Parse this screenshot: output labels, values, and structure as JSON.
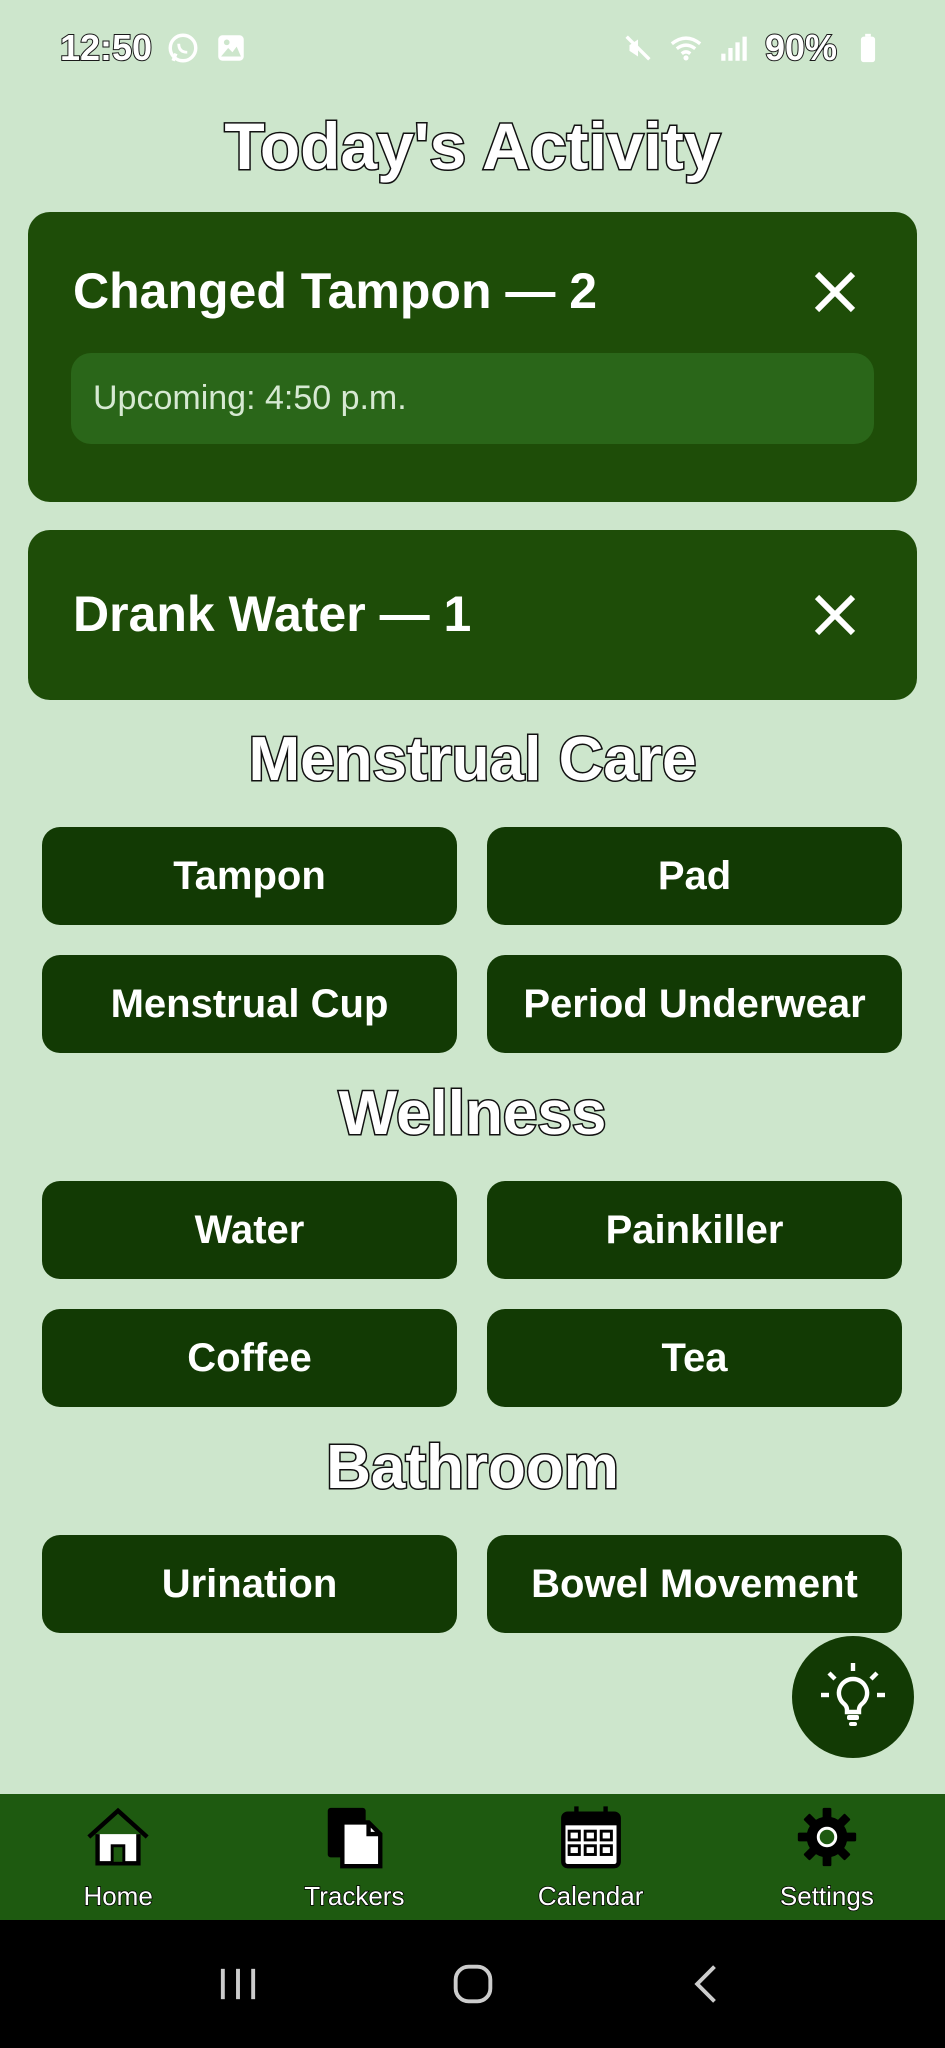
{
  "status_bar": {
    "time": "12:50",
    "battery": "90%"
  },
  "title": "Today's Activity",
  "activity_cards": [
    {
      "title": "Changed Tampon — 2",
      "upcoming": "Upcoming: 4:50 p.m."
    },
    {
      "title": "Drank Water — 1"
    }
  ],
  "sections": [
    {
      "title": "Menstrual Care",
      "buttons": [
        "Tampon",
        "Pad",
        "Menstrual Cup",
        "Period Underwear"
      ]
    },
    {
      "title": "Wellness",
      "buttons": [
        "Water",
        "Painkiller",
        "Coffee",
        "Tea"
      ]
    },
    {
      "title": "Bathroom",
      "buttons": [
        "Urination",
        "Bowel Movement"
      ]
    }
  ],
  "fab": {
    "icon": "lightbulb-icon"
  },
  "bottom_nav": [
    {
      "label": "Home",
      "icon": "home-icon"
    },
    {
      "label": "Trackers",
      "icon": "trackers-icon"
    },
    {
      "label": "Calendar",
      "icon": "calendar-icon"
    },
    {
      "label": "Settings",
      "icon": "gear-icon"
    }
  ],
  "colors": {
    "background": "#cde6cc",
    "card": "#1e4d08",
    "button": "#123a04",
    "nav_bar": "#1e5a10"
  }
}
